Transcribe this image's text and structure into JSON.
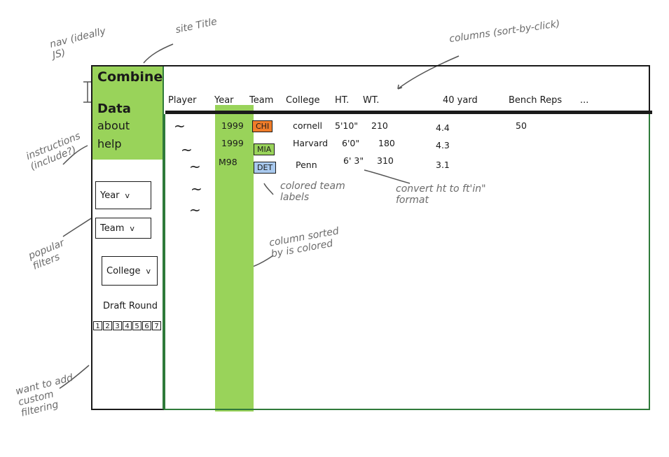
{
  "annotations": {
    "nav": "nav (ideally JS)",
    "site_title": "site Title",
    "columns": "columns (sort-by-click)",
    "instructions": "instructions (include?)",
    "popular_filters": "popular filters",
    "custom_filtering": "want to add custom filtering",
    "colored_team_labels": "colored team labels",
    "convert_ht": "convert ht to ft'in\" format",
    "column_sorted": "column sorted by is colored"
  },
  "sidebar": {
    "title": "Combine",
    "nav_items": [
      "Data",
      "about",
      "help"
    ],
    "filters": [
      "Year",
      "Team",
      "College"
    ],
    "draft_round_label": "Draft Round",
    "draft_rounds": [
      "1",
      "2",
      "3",
      "4",
      "5",
      "6",
      "7"
    ]
  },
  "table": {
    "headers": [
      "Player",
      "Year",
      "Team",
      "College",
      "HT.",
      "WT.",
      "40 yard",
      "Bench Reps",
      "..."
    ],
    "player_placeholder": "~",
    "rows": [
      {
        "year": "1999",
        "team": "CHI",
        "college": "cornell",
        "ht": "5'10\"",
        "wt": "210",
        "forty": "4.4",
        "bench": "50"
      },
      {
        "year": "1999",
        "team": "MIA",
        "college": "Harvard",
        "ht": "6'0\"",
        "wt": "180",
        "forty": "4.3",
        "bench": ""
      },
      {
        "year": "M98",
        "team": "DET",
        "college": "Penn",
        "ht": "6' 3\"",
        "wt": "310",
        "forty": "3.1",
        "bench": ""
      }
    ]
  },
  "colors": {
    "highlight": "#99d35a",
    "team_chi": "#f07d2a",
    "team_mia": "#99d35a",
    "team_det": "#a9c9ee",
    "frame_green": "#2f7a3a"
  }
}
